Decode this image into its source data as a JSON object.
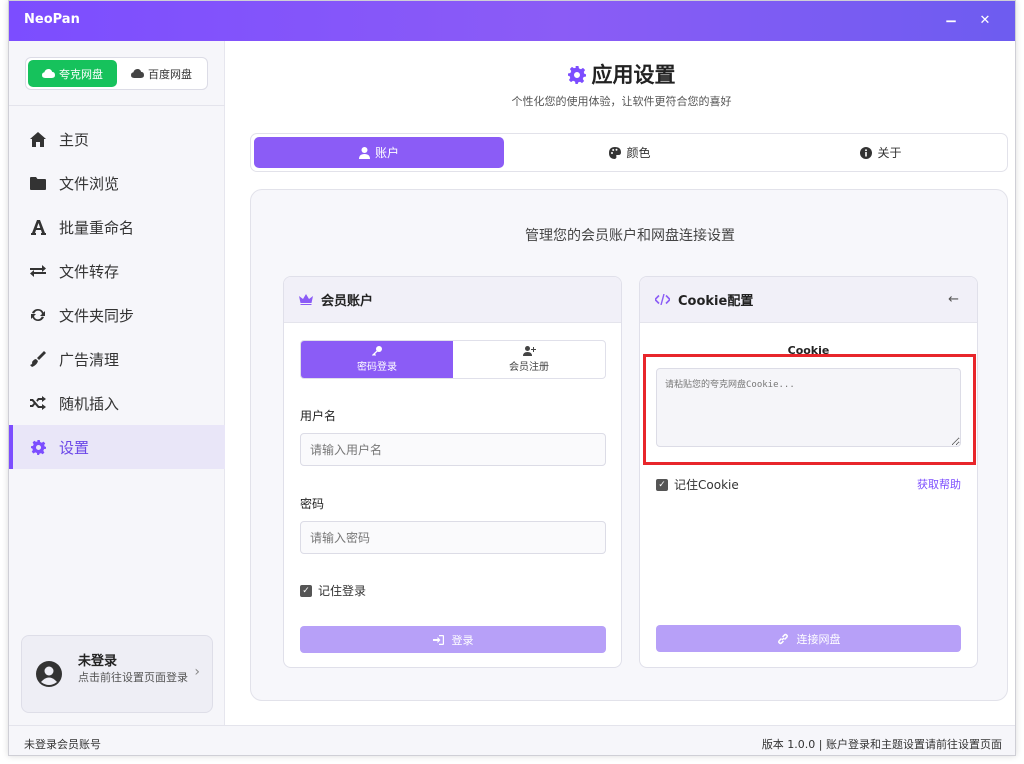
{
  "window": {
    "title": "NeoPan",
    "minimize_label": "−",
    "close_label": "✕",
    "accent_color": "#7c4dff"
  },
  "sidebar": {
    "drive_switch": [
      {
        "label": "夸克网盘",
        "icon": "cloud-icon",
        "active": true,
        "color": "#16c25c"
      },
      {
        "label": "百度网盘",
        "icon": "cloud-icon",
        "active": false
      }
    ],
    "nav_items": [
      {
        "label": "主页",
        "icon": "home-icon"
      },
      {
        "label": "文件浏览",
        "icon": "folder-icon"
      },
      {
        "label": "批量重命名",
        "icon": "font-icon"
      },
      {
        "label": "文件转存",
        "icon": "exchange-icon"
      },
      {
        "label": "文件夹同步",
        "icon": "sync-icon"
      },
      {
        "label": "广告清理",
        "icon": "broom-icon"
      },
      {
        "label": "随机插入",
        "icon": "shuffle-icon"
      },
      {
        "label": "设置",
        "icon": "gear-icon",
        "active": true
      }
    ],
    "user": {
      "name": "未登录",
      "hint": "点击前往设置页面登录",
      "icon": "user-circle-icon"
    }
  },
  "main": {
    "title": "应用设置",
    "subtitle": "个性化您的使用体验，让软件更符合您的喜好",
    "tabs": [
      {
        "label": "账户",
        "icon": "user-icon",
        "active": true
      },
      {
        "label": "颜色",
        "icon": "palette-icon",
        "active": false
      },
      {
        "label": "关于",
        "icon": "info-icon",
        "active": false
      }
    ],
    "description": "管理您的会员账户和网盘连接设置",
    "member_card": {
      "title": "会员账户",
      "icon": "crown-icon",
      "subtabs": [
        {
          "label": "密码登录",
          "icon": "key-icon",
          "active": true
        },
        {
          "label": "会员注册",
          "icon": "user-plus-icon",
          "active": false
        }
      ],
      "username_label": "用户名",
      "username_placeholder": "请输入用户名",
      "password_label": "密码",
      "password_placeholder": "请输入密码",
      "remember_label": "记住登录",
      "remember_checked": true,
      "login_button": "登录"
    },
    "cookie_card": {
      "title": "Cookie配置",
      "icon": "code-icon",
      "back_icon": "arrow-left-icon",
      "field_label": "Cookie",
      "placeholder": "请粘贴您的夸克网盘Cookie...",
      "remember_label": "记住Cookie",
      "remember_checked": true,
      "help_link": "获取帮助",
      "connect_button": "连接网盘",
      "highlight_color": "#e8262b"
    }
  },
  "statusbar": {
    "left": "未登录会员账号",
    "right": "版本 1.0.0 | 账户登录和主题设置请前往设置页面"
  }
}
